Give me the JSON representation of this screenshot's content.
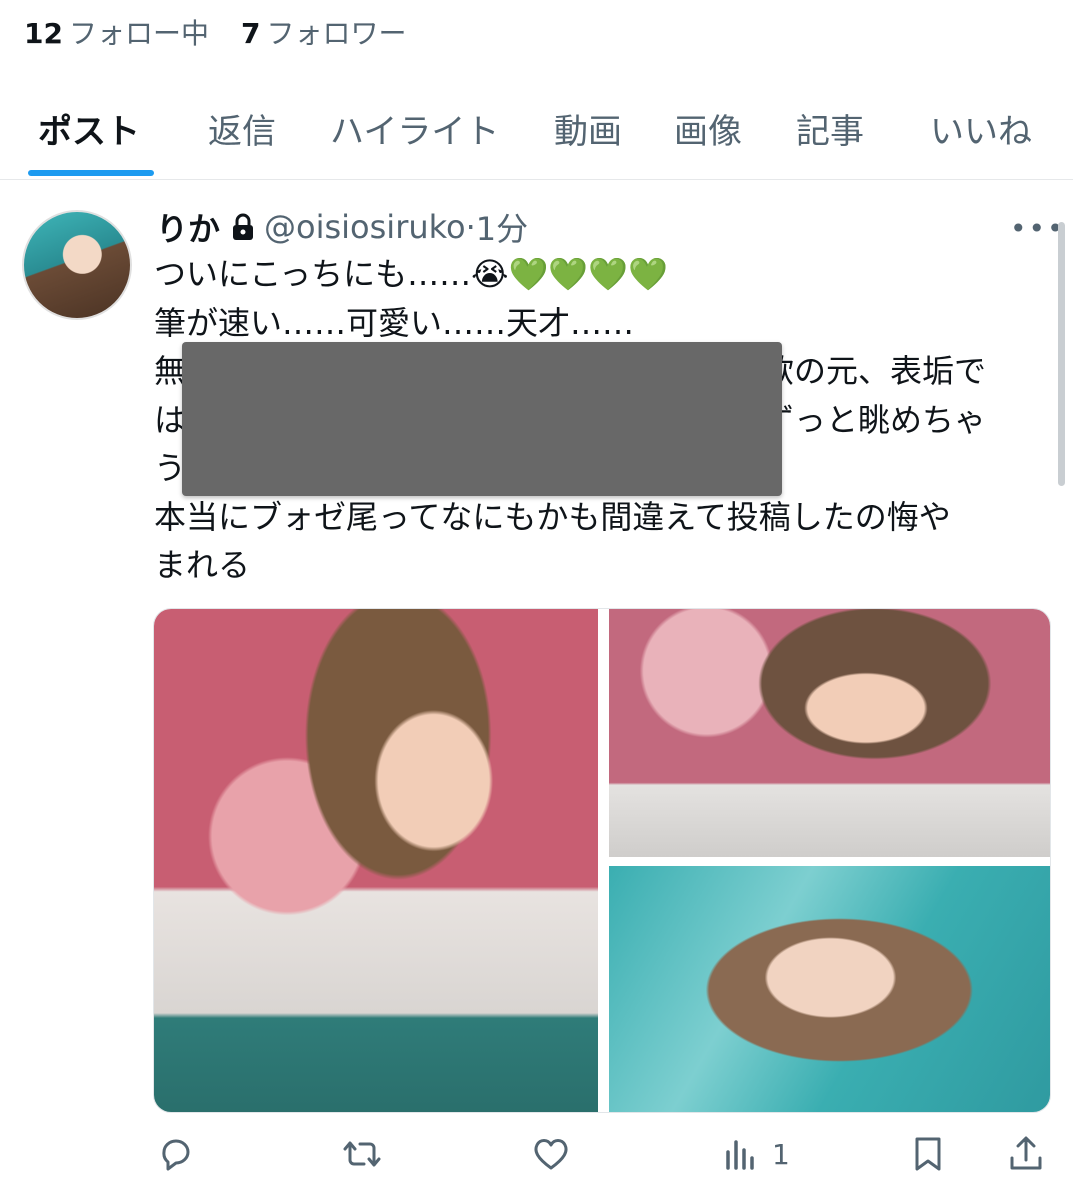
{
  "profile_stats": {
    "following_count": "12",
    "following_label": "フォロー中",
    "followers_count": "7",
    "followers_label": "フォロワー"
  },
  "tabs": [
    {
      "label": "ポスト",
      "active": true
    },
    {
      "label": "返信",
      "active": false
    },
    {
      "label": "ハイライト",
      "active": false
    },
    {
      "label": "動画",
      "active": false
    },
    {
      "label": "画像",
      "active": false
    },
    {
      "label": "記事",
      "active": false
    },
    {
      "label": "いいね",
      "active": false
    }
  ],
  "post": {
    "author_name": "りか",
    "locked_icon": "lock-icon",
    "handle": "@oisiosiruko",
    "separator": "·",
    "time": "1分",
    "text": "ついにこっちにも……😭💚💚💚💚\n筆が速い……可愛い……天才……\n無　　　　　　　　　　　　　　　　　　欲の元、表垢で\nは　　　　　　　　　　　　　　　　　　ずっと眺めちゃ\nう\n本当にブォゼ尾ってなにもかも間違えて投稿したの悔や\nまれる",
    "image_count": 3,
    "actions": {
      "reply_icon": "reply-icon",
      "repost_icon": "repost-icon",
      "like_icon": "heart-icon",
      "views_icon": "views-icon",
      "views_count": "1",
      "bookmark_icon": "bookmark-icon",
      "share_icon": "share-icon"
    }
  },
  "colors": {
    "accent": "#1d9bf0",
    "secondary_text": "#536471",
    "primary_text": "#0f1419",
    "redaction": "#686868"
  }
}
